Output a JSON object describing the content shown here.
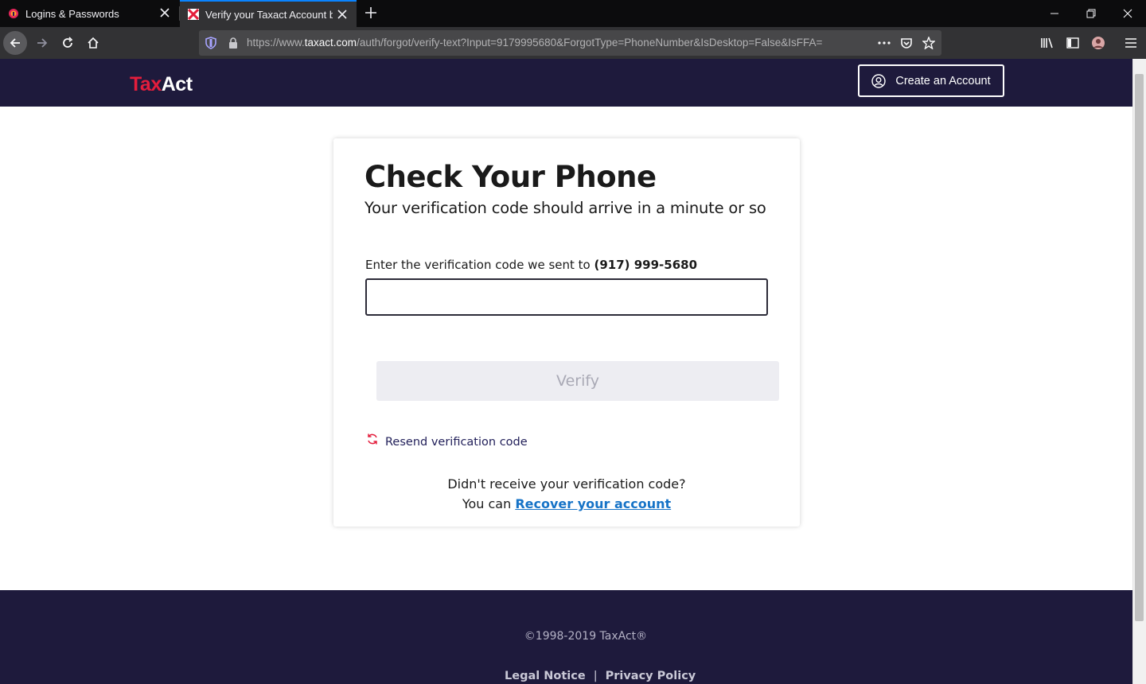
{
  "browser": {
    "tabs": [
      {
        "title": "Logins & Passwords",
        "icon": "lockwise-icon",
        "active": false
      },
      {
        "title": "Verify your Taxact Account by t",
        "icon": "taxact-favicon",
        "active": true
      }
    ],
    "url": {
      "prefix": "https://www.",
      "domain": "taxact.com",
      "path": "/auth/forgot/verify-text?Input=9179995680&ForgotType=PhoneNumber&IsDesktop=False&IsFFA="
    }
  },
  "header": {
    "logo": {
      "part1": "Tax",
      "part2": "Act"
    },
    "create_account_label": "Create an Account"
  },
  "card": {
    "title": "Check Your Phone",
    "subtitle": "Your verification code should arrive in a minute or so",
    "field_label": "Enter the verification code we sent to ",
    "phone": "(917) 999-5680",
    "input_value": "",
    "verify_label": "Verify",
    "resend_label": "Resend verification code",
    "help_line1": "Didn't receive your verification code?",
    "help_line2_prefix": "You can ",
    "recover_link": "Recover your account"
  },
  "footer": {
    "copyright": "©1998-2019 TaxAct®",
    "links": [
      "Legal Notice",
      "Privacy Policy"
    ],
    "separator": "|"
  },
  "colors": {
    "brand_navy": "#1e1a3c",
    "brand_red": "#e31d3c",
    "link_blue": "#1673c7"
  }
}
